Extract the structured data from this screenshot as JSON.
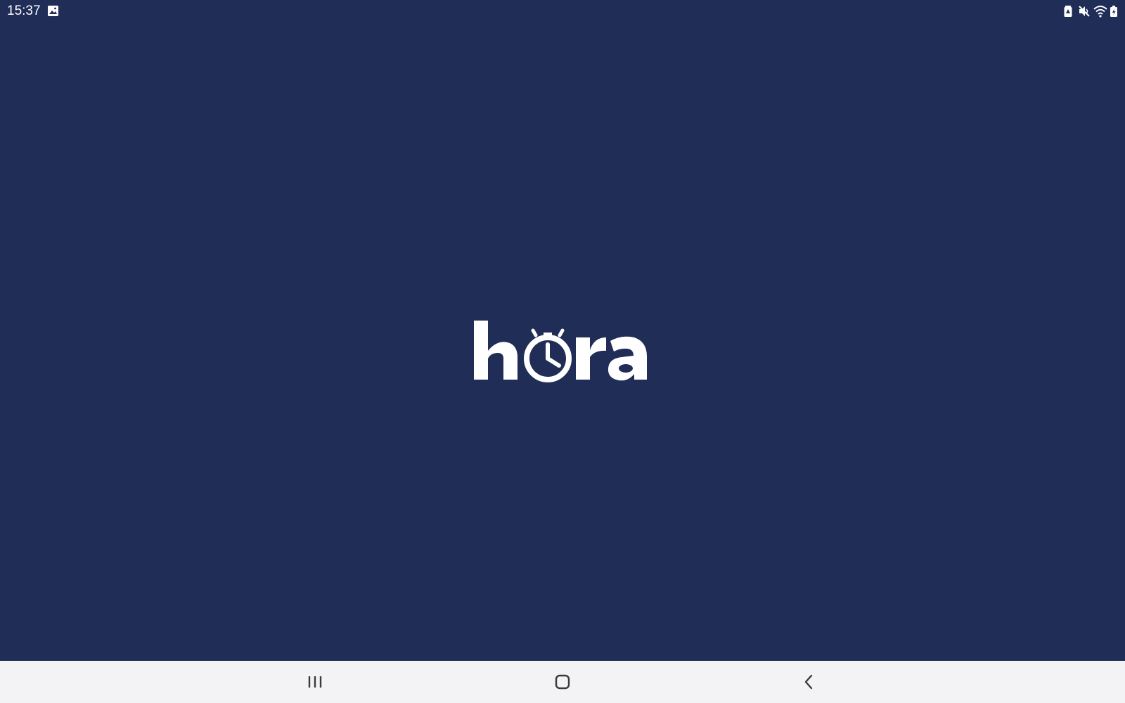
{
  "status_bar": {
    "time": "15:37",
    "left_icons": [
      "image-notification-icon"
    ],
    "right_icons": [
      "battery-saver-icon",
      "mute-icon",
      "wifi-icon",
      "battery-icon"
    ]
  },
  "splash": {
    "logo_text": "hora",
    "logo_icon": "stopwatch-icon"
  },
  "nav_bar": {
    "buttons": [
      "recents-button",
      "home-button",
      "back-button"
    ]
  },
  "colors": {
    "background": "#1f2d57",
    "logo": "#ffffff",
    "nav_bar": "#f3f3f5",
    "nav_icon": "#3a3a3a"
  }
}
